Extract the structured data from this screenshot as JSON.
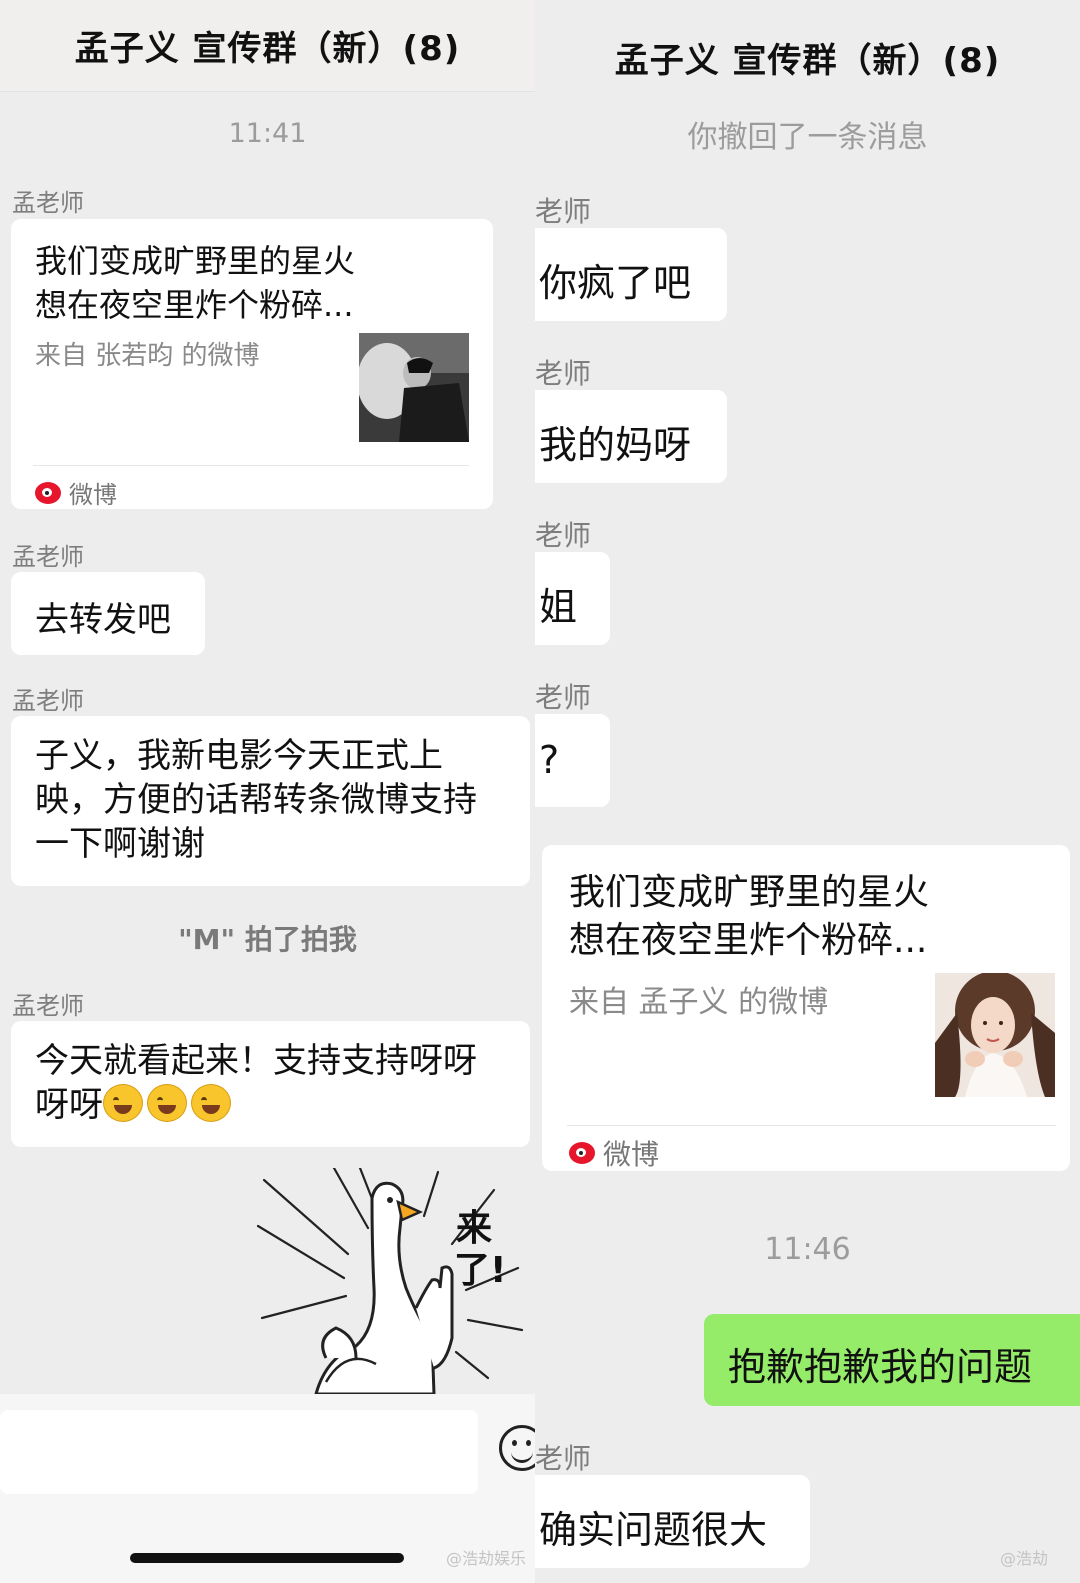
{
  "left": {
    "title": "孟子义 宣传群（新）(8)",
    "time": "11:41",
    "messages": {
      "m1": {
        "sender": "孟老师",
        "card_line1": "我们变成旷野里的星火",
        "card_line2": "想在夜空里炸个粉碎...",
        "card_source": "来自 张若昀 的微博",
        "card_app": "微博"
      },
      "m2": {
        "sender": "孟老师",
        "text": "去转发吧"
      },
      "m3": {
        "sender": "孟老师",
        "line1": "子义，我新电影今天正式上",
        "line2": "映，方便的话帮转条微博支持",
        "line3": "一下啊谢谢"
      },
      "pat": "\"M\" 拍了拍我",
      "m4": {
        "sender": "孟老师",
        "line1": "今天就看起来！支持支持呀呀",
        "line2": "呀呀"
      },
      "sticker_text": "来了!"
    },
    "watermark": "@浩劫娱乐"
  },
  "right": {
    "title": "孟子义 宣传群（新）(8)",
    "recall": "你撤回了一条消息",
    "messages": [
      {
        "sender": "老师",
        "text": "你疯了吧"
      },
      {
        "sender": "老师",
        "text": "我的妈呀"
      },
      {
        "sender": "老师",
        "text": "姐"
      },
      {
        "sender": "老师",
        "text": "?"
      }
    ],
    "card": {
      "line1": "我们变成旷野里的星火",
      "line2": "想在夜空里炸个粉碎...",
      "source": "来自 孟子义 的微博",
      "app": "微博"
    },
    "time": "11:46",
    "my_message": "抱歉抱歉我的问题",
    "last": {
      "sender": "老师",
      "text": "确实问题很大"
    },
    "watermark": "@浩劫"
  },
  "colors": {
    "bg": "#ededed",
    "bubble": "#ffffff",
    "my_bubble": "#95ec69",
    "weibo": "#e6162d"
  }
}
